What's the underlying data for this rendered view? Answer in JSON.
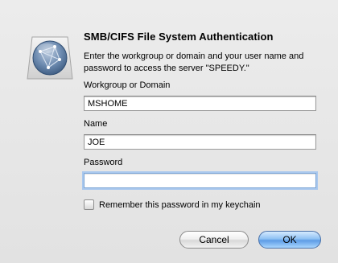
{
  "dialog": {
    "title": "SMB/CIFS File System Authentication",
    "message": "Enter the workgroup or domain and your user name and password to access the server \"SPEEDY.\"",
    "icon": "network-globe-icon"
  },
  "fields": {
    "workgroup_label": "Workgroup or Domain",
    "workgroup_value": "MSHOME",
    "name_label": "Name",
    "name_value": "JOE",
    "password_label": "Password",
    "password_value": ""
  },
  "checkbox": {
    "label": "Remember this password in my keychain",
    "checked": false
  },
  "buttons": {
    "cancel_label": "Cancel",
    "ok_label": "OK"
  },
  "colors": {
    "accent": "#5d9ce6",
    "focus_ring": "#a9c8ee"
  }
}
